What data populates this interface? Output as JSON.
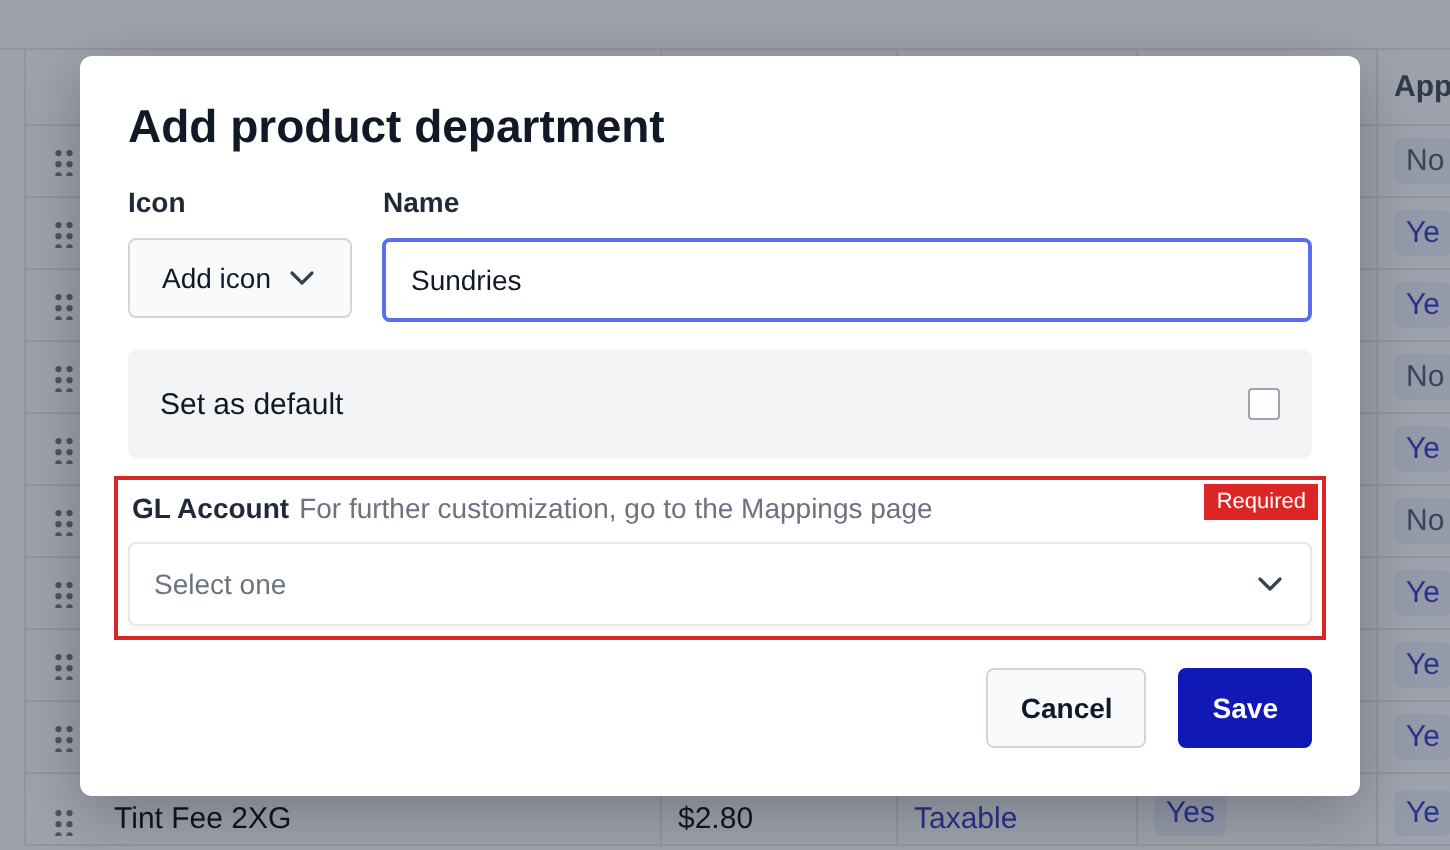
{
  "background_table": {
    "header": "App",
    "rows": [
      {
        "app": {
          "text": "No",
          "kind": "negative"
        }
      },
      {
        "app": {
          "text": "Ye",
          "kind": "positive"
        }
      },
      {
        "app": {
          "text": "Ye",
          "kind": "positive"
        }
      },
      {
        "app": {
          "text": "No",
          "kind": "negative"
        }
      },
      {
        "app": {
          "text": "Ye",
          "kind": "positive"
        }
      },
      {
        "app": {
          "text": "No",
          "kind": "negative"
        }
      },
      {
        "app": {
          "text": "Ye",
          "kind": "positive"
        }
      },
      {
        "app": {
          "text": "Ye",
          "kind": "positive"
        }
      },
      {
        "app": {
          "text": "Ye",
          "kind": "positive"
        }
      },
      {
        "name": "Tint Fee 2XG",
        "price": "$2.80",
        "tax": "Taxable",
        "flag": "Yes",
        "app": {
          "text": "Ye",
          "kind": "positive"
        }
      }
    ]
  },
  "dialog": {
    "title": "Add product department",
    "icon_field": {
      "label": "Icon",
      "button": "Add icon"
    },
    "name_field": {
      "label": "Name",
      "value": "Sundries",
      "focused": true
    },
    "default_toggle": {
      "label": "Set as default",
      "checked": false
    },
    "gl_account": {
      "label": "GL Account",
      "hint": "For further customization, go to the Mappings page",
      "badge": "Required",
      "error": true,
      "placeholder": "Select one"
    },
    "buttons": [
      {
        "label": "Cancel",
        "kind": "secondary"
      },
      {
        "label": "Save",
        "kind": "primary"
      }
    ]
  }
}
